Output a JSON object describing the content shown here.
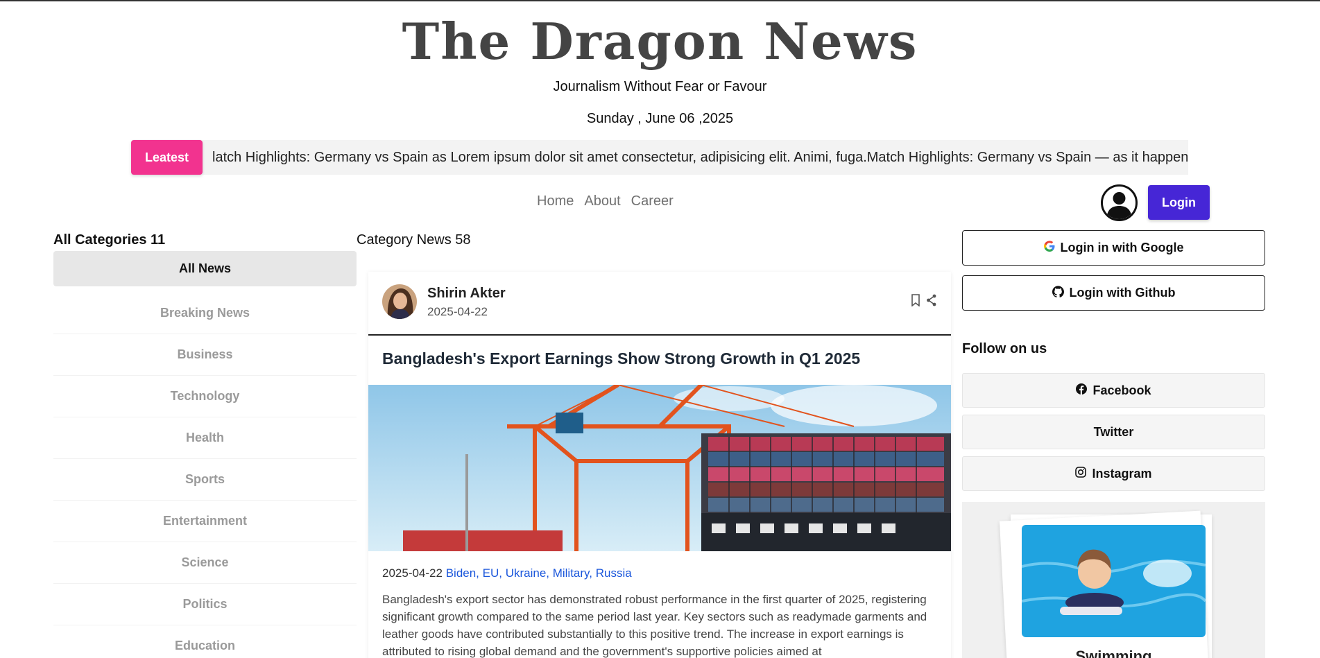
{
  "header": {
    "logo": "The Dragon News",
    "tagline": "Journalism Without Fear or Favour",
    "date": "Sunday , June 06 ,2025"
  },
  "ticker": {
    "badge": "Leatest",
    "text": "latch Highlights: Germany vs Spain as Lorem ipsum dolor sit amet consectetur, adipisicing elit. Animi, fuga.Match Highlights: Germany vs Spain — as it happen"
  },
  "nav": {
    "items": [
      "Home",
      "About",
      "Career"
    ],
    "login": "Login"
  },
  "sidebar": {
    "title": "All Categories 11",
    "categories": [
      "All News",
      "Breaking News",
      "Business",
      "Technology",
      "Health",
      "Sports",
      "Entertainment",
      "Science",
      "Politics",
      "Education"
    ]
  },
  "main": {
    "title": "Category News 58",
    "article": {
      "author": "Shirin Akter",
      "author_date": "2025-04-22",
      "headline": "Bangladesh's Export Earnings Show Strong Growth in Q1 2025",
      "meta_date": "2025-04-22",
      "tags": "Biden, EU, Ukraine, Military, Russia",
      "excerpt": "Bangladesh's export sector has demonstrated robust performance in the first quarter of 2025, registering significant growth compared to the same period last year. Key sectors such as readymade garments and leather goods have contributed substantially to this positive trend. The increase in export earnings is attributed to rising global demand and the government's supportive policies aimed at"
    }
  },
  "right": {
    "google": "Login in with Google",
    "github": "Login with Github",
    "follow_title": "Follow on us",
    "facebook": "Facebook",
    "twitter": "Twitter",
    "instagram": "Instagram",
    "qzone_label": "Swimming"
  },
  "colors": {
    "latest": "#f2338f",
    "login": "#4626d6",
    "tag_link": "#1a56db"
  }
}
